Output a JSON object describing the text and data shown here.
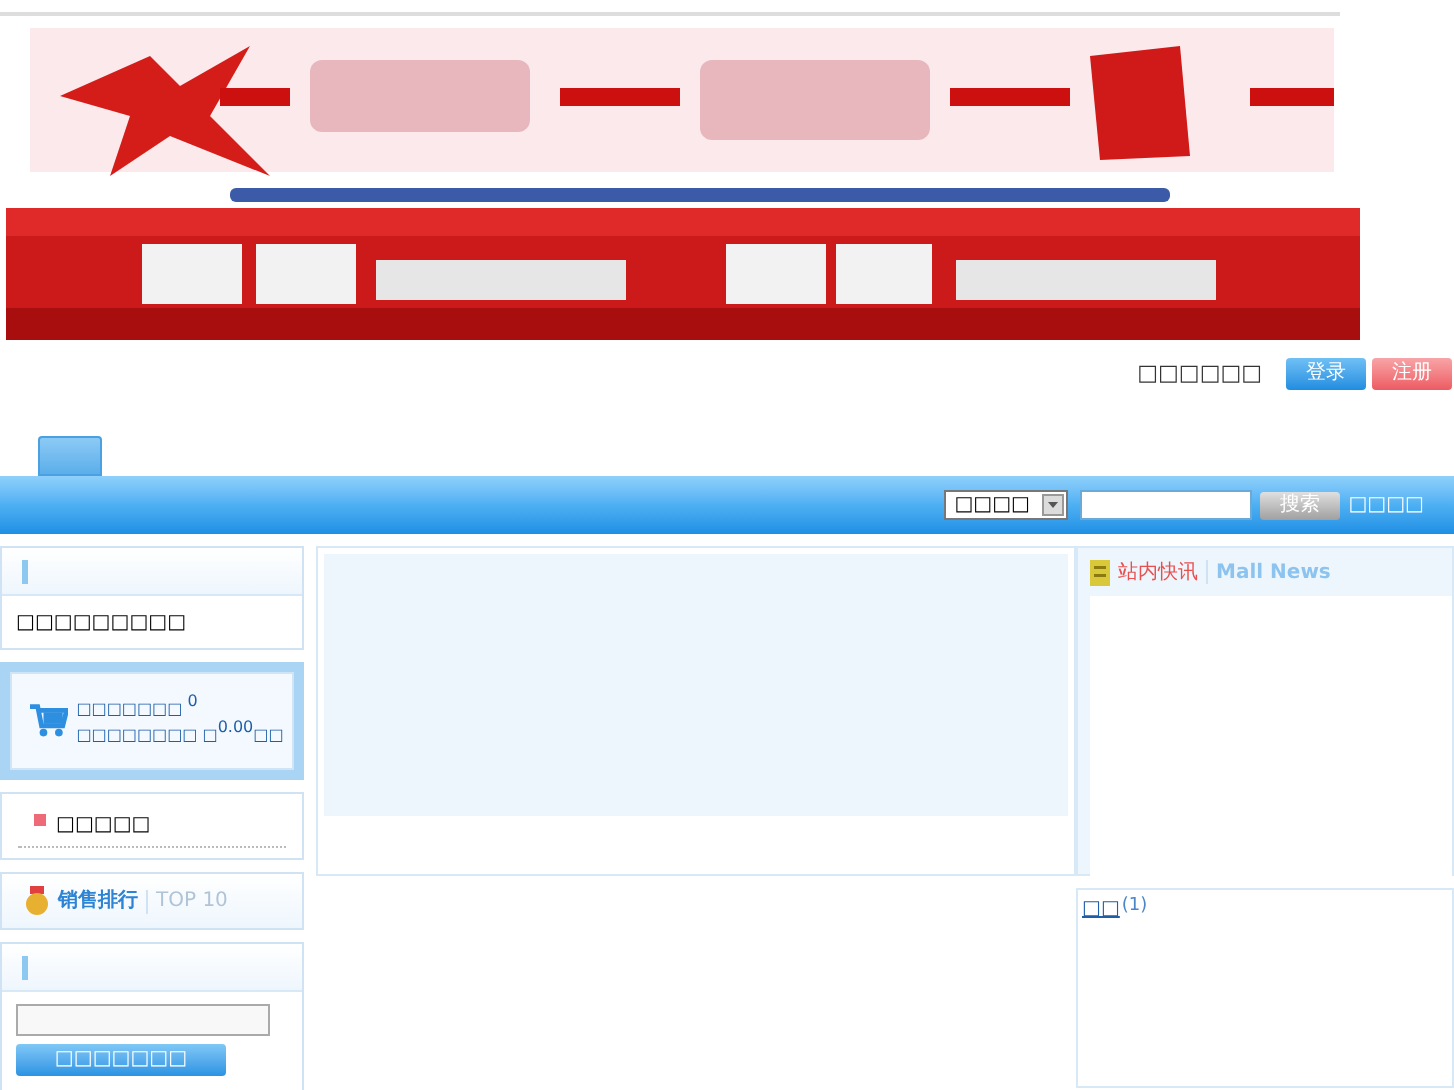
{
  "user_bar": {
    "greeting": "□□□□□□",
    "login_button": "登录",
    "register_button": "注册"
  },
  "search_bar": {
    "category": "□□□□",
    "search_button": "搜索",
    "advanced_link": "□□□□"
  },
  "sidebar": {
    "welcome": "□□□□□□□□□",
    "cart": {
      "before": "□□□□□□□",
      "count": "0",
      "middle": "□□□□□□□□",
      "after_prefix": "□",
      "total": "0.00",
      "after_suffix": "□□"
    },
    "category": "□□□□□",
    "ranking": {
      "title": "销售排行",
      "subtitle": "TOP 10"
    },
    "login_button": "□□□□□□□"
  },
  "news": {
    "title": "站内快讯",
    "subtitle": "Mall News"
  },
  "bottom_right": {
    "label": "□□",
    "count": "(1)"
  }
}
